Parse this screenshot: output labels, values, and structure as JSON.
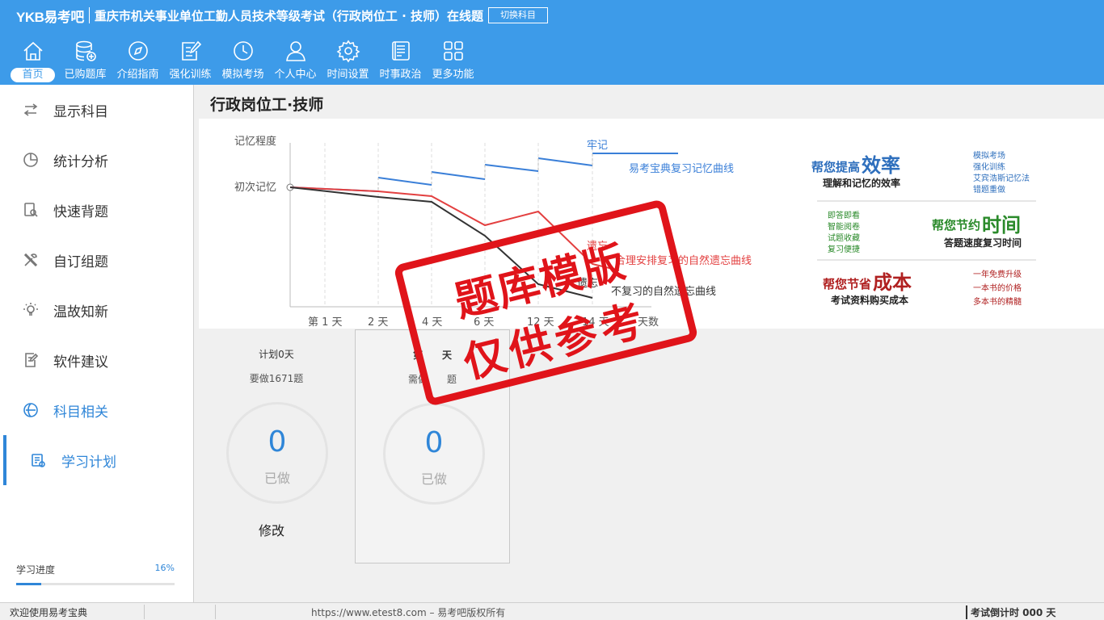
{
  "header": {
    "brand": "YKB易考吧",
    "exam_title": "重庆市机关事业单位工勤人员技术等级考试（行政岗位工 · 技师）在线题",
    "switch_label": "切换科目"
  },
  "nav": [
    {
      "label": "首页",
      "icon": "home-icon"
    },
    {
      "label": "已购题库",
      "icon": "database-icon"
    },
    {
      "label": "介绍指南",
      "icon": "compass-icon"
    },
    {
      "label": "强化训练",
      "icon": "edit-icon"
    },
    {
      "label": "模拟考场",
      "icon": "clock-icon"
    },
    {
      "label": "个人中心",
      "icon": "user-icon"
    },
    {
      "label": "时间设置",
      "icon": "gear-icon"
    },
    {
      "label": "时事政治",
      "icon": "news-icon"
    },
    {
      "label": "更多功能",
      "icon": "grid-icon"
    }
  ],
  "sidebar": {
    "items": [
      {
        "label": "显示科目"
      },
      {
        "label": "统计分析"
      },
      {
        "label": "快速背题"
      },
      {
        "label": "自订组题"
      },
      {
        "label": "温故知新"
      },
      {
        "label": "软件建议"
      },
      {
        "label": "科目相关"
      }
    ],
    "sub_item": "学习计划",
    "progress_label": "学习进度",
    "progress_text": "16%",
    "progress_value": 0.16
  },
  "main": {
    "title": "行政岗位工·技师"
  },
  "banner": {
    "y_label": "记忆程度",
    "first_memory": "初次记忆",
    "x_ticks": [
      "第 1 天",
      "2 天",
      "4 天",
      "6 天",
      "12 天",
      "14 天",
      "天数"
    ],
    "remember": "牢记",
    "ykb_curve": "易考宝典复习记忆曲线",
    "forget1": "遗忘",
    "reasonable_curve": "合理安排复习的自然遗忘曲线",
    "forget2": "遗忘",
    "natural_curve": "不复习的自然遗忘曲线",
    "promo": {
      "eff_prefix": "帮您提高",
      "eff_big": "效率",
      "eff_sub": "理解和记忆的效率",
      "eff_list": [
        "模拟考场",
        "强化训练",
        "艾宾浩斯记忆法",
        "错题重做"
      ],
      "time_list": [
        "即答即看",
        "智能阅卷",
        "试题收藏",
        "复习便捷"
      ],
      "time_prefix": "帮您节约",
      "time_big": "时间",
      "time_sub": "答题速度复习时间",
      "cost_prefix": "帮您节省",
      "cost_big": "成本",
      "cost_sub": "考试资料购买成本",
      "cost_list": [
        "一年免费升级",
        "一本书的价格",
        "多本书的精髓"
      ]
    }
  },
  "plan": {
    "card1_line1": "计划0天",
    "card1_line2": "要做1671题",
    "card1_count": "0",
    "card1_done": "已做",
    "card2_line1": "第　　天",
    "card2_line2": "需做　　题",
    "card2_count": "0",
    "card2_done": "已做",
    "modify": "修改"
  },
  "stamp": {
    "line1": "题库模版",
    "line2": "仅供参考"
  },
  "status": {
    "welcome": "欢迎使用易考宝典",
    "copyright": "https://www.etest8.com – 易考吧版权所有",
    "countdown": "考试倒计时 000 天"
  },
  "colors": {
    "header": "#3d9be9",
    "accent": "#2f86d8",
    "stamp": "#e0141a"
  }
}
